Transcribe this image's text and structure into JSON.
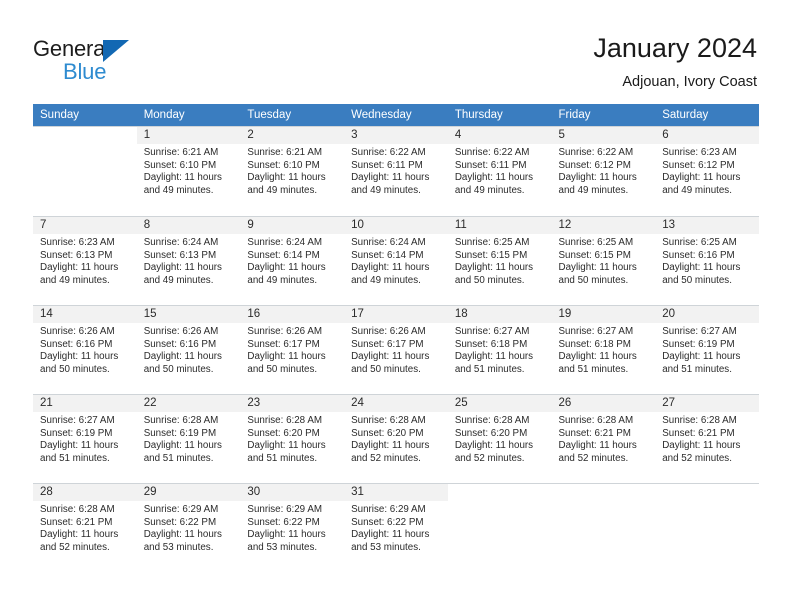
{
  "brand": {
    "name_part1": "General",
    "name_part2": "Blue",
    "accent_color": "#2e8bd0",
    "triangle_color": "#1268b3"
  },
  "header": {
    "title": "January 2024",
    "subtitle": "Adjouan, Ivory Coast"
  },
  "calendar": {
    "header_color": "#3a7dc0",
    "weekdays": [
      "Sunday",
      "Monday",
      "Tuesday",
      "Wednesday",
      "Thursday",
      "Friday",
      "Saturday"
    ],
    "weeks": [
      [
        {
          "day": "",
          "sunrise": "",
          "sunset": "",
          "daylight1": "",
          "daylight2": ""
        },
        {
          "day": "1",
          "sunrise": "Sunrise: 6:21 AM",
          "sunset": "Sunset: 6:10 PM",
          "daylight1": "Daylight: 11 hours",
          "daylight2": "and 49 minutes."
        },
        {
          "day": "2",
          "sunrise": "Sunrise: 6:21 AM",
          "sunset": "Sunset: 6:10 PM",
          "daylight1": "Daylight: 11 hours",
          "daylight2": "and 49 minutes."
        },
        {
          "day": "3",
          "sunrise": "Sunrise: 6:22 AM",
          "sunset": "Sunset: 6:11 PM",
          "daylight1": "Daylight: 11 hours",
          "daylight2": "and 49 minutes."
        },
        {
          "day": "4",
          "sunrise": "Sunrise: 6:22 AM",
          "sunset": "Sunset: 6:11 PM",
          "daylight1": "Daylight: 11 hours",
          "daylight2": "and 49 minutes."
        },
        {
          "day": "5",
          "sunrise": "Sunrise: 6:22 AM",
          "sunset": "Sunset: 6:12 PM",
          "daylight1": "Daylight: 11 hours",
          "daylight2": "and 49 minutes."
        },
        {
          "day": "6",
          "sunrise": "Sunrise: 6:23 AM",
          "sunset": "Sunset: 6:12 PM",
          "daylight1": "Daylight: 11 hours",
          "daylight2": "and 49 minutes."
        }
      ],
      [
        {
          "day": "7",
          "sunrise": "Sunrise: 6:23 AM",
          "sunset": "Sunset: 6:13 PM",
          "daylight1": "Daylight: 11 hours",
          "daylight2": "and 49 minutes."
        },
        {
          "day": "8",
          "sunrise": "Sunrise: 6:24 AM",
          "sunset": "Sunset: 6:13 PM",
          "daylight1": "Daylight: 11 hours",
          "daylight2": "and 49 minutes."
        },
        {
          "day": "9",
          "sunrise": "Sunrise: 6:24 AM",
          "sunset": "Sunset: 6:14 PM",
          "daylight1": "Daylight: 11 hours",
          "daylight2": "and 49 minutes."
        },
        {
          "day": "10",
          "sunrise": "Sunrise: 6:24 AM",
          "sunset": "Sunset: 6:14 PM",
          "daylight1": "Daylight: 11 hours",
          "daylight2": "and 49 minutes."
        },
        {
          "day": "11",
          "sunrise": "Sunrise: 6:25 AM",
          "sunset": "Sunset: 6:15 PM",
          "daylight1": "Daylight: 11 hours",
          "daylight2": "and 50 minutes."
        },
        {
          "day": "12",
          "sunrise": "Sunrise: 6:25 AM",
          "sunset": "Sunset: 6:15 PM",
          "daylight1": "Daylight: 11 hours",
          "daylight2": "and 50 minutes."
        },
        {
          "day": "13",
          "sunrise": "Sunrise: 6:25 AM",
          "sunset": "Sunset: 6:16 PM",
          "daylight1": "Daylight: 11 hours",
          "daylight2": "and 50 minutes."
        }
      ],
      [
        {
          "day": "14",
          "sunrise": "Sunrise: 6:26 AM",
          "sunset": "Sunset: 6:16 PM",
          "daylight1": "Daylight: 11 hours",
          "daylight2": "and 50 minutes."
        },
        {
          "day": "15",
          "sunrise": "Sunrise: 6:26 AM",
          "sunset": "Sunset: 6:16 PM",
          "daylight1": "Daylight: 11 hours",
          "daylight2": "and 50 minutes."
        },
        {
          "day": "16",
          "sunrise": "Sunrise: 6:26 AM",
          "sunset": "Sunset: 6:17 PM",
          "daylight1": "Daylight: 11 hours",
          "daylight2": "and 50 minutes."
        },
        {
          "day": "17",
          "sunrise": "Sunrise: 6:26 AM",
          "sunset": "Sunset: 6:17 PM",
          "daylight1": "Daylight: 11 hours",
          "daylight2": "and 50 minutes."
        },
        {
          "day": "18",
          "sunrise": "Sunrise: 6:27 AM",
          "sunset": "Sunset: 6:18 PM",
          "daylight1": "Daylight: 11 hours",
          "daylight2": "and 51 minutes."
        },
        {
          "day": "19",
          "sunrise": "Sunrise: 6:27 AM",
          "sunset": "Sunset: 6:18 PM",
          "daylight1": "Daylight: 11 hours",
          "daylight2": "and 51 minutes."
        },
        {
          "day": "20",
          "sunrise": "Sunrise: 6:27 AM",
          "sunset": "Sunset: 6:19 PM",
          "daylight1": "Daylight: 11 hours",
          "daylight2": "and 51 minutes."
        }
      ],
      [
        {
          "day": "21",
          "sunrise": "Sunrise: 6:27 AM",
          "sunset": "Sunset: 6:19 PM",
          "daylight1": "Daylight: 11 hours",
          "daylight2": "and 51 minutes."
        },
        {
          "day": "22",
          "sunrise": "Sunrise: 6:28 AM",
          "sunset": "Sunset: 6:19 PM",
          "daylight1": "Daylight: 11 hours",
          "daylight2": "and 51 minutes."
        },
        {
          "day": "23",
          "sunrise": "Sunrise: 6:28 AM",
          "sunset": "Sunset: 6:20 PM",
          "daylight1": "Daylight: 11 hours",
          "daylight2": "and 51 minutes."
        },
        {
          "day": "24",
          "sunrise": "Sunrise: 6:28 AM",
          "sunset": "Sunset: 6:20 PM",
          "daylight1": "Daylight: 11 hours",
          "daylight2": "and 52 minutes."
        },
        {
          "day": "25",
          "sunrise": "Sunrise: 6:28 AM",
          "sunset": "Sunset: 6:20 PM",
          "daylight1": "Daylight: 11 hours",
          "daylight2": "and 52 minutes."
        },
        {
          "day": "26",
          "sunrise": "Sunrise: 6:28 AM",
          "sunset": "Sunset: 6:21 PM",
          "daylight1": "Daylight: 11 hours",
          "daylight2": "and 52 minutes."
        },
        {
          "day": "27",
          "sunrise": "Sunrise: 6:28 AM",
          "sunset": "Sunset: 6:21 PM",
          "daylight1": "Daylight: 11 hours",
          "daylight2": "and 52 minutes."
        }
      ],
      [
        {
          "day": "28",
          "sunrise": "Sunrise: 6:28 AM",
          "sunset": "Sunset: 6:21 PM",
          "daylight1": "Daylight: 11 hours",
          "daylight2": "and 52 minutes."
        },
        {
          "day": "29",
          "sunrise": "Sunrise: 6:29 AM",
          "sunset": "Sunset: 6:22 PM",
          "daylight1": "Daylight: 11 hours",
          "daylight2": "and 53 minutes."
        },
        {
          "day": "30",
          "sunrise": "Sunrise: 6:29 AM",
          "sunset": "Sunset: 6:22 PM",
          "daylight1": "Daylight: 11 hours",
          "daylight2": "and 53 minutes."
        },
        {
          "day": "31",
          "sunrise": "Sunrise: 6:29 AM",
          "sunset": "Sunset: 6:22 PM",
          "daylight1": "Daylight: 11 hours",
          "daylight2": "and 53 minutes."
        },
        {
          "day": "",
          "sunrise": "",
          "sunset": "",
          "daylight1": "",
          "daylight2": ""
        },
        {
          "day": "",
          "sunrise": "",
          "sunset": "",
          "daylight1": "",
          "daylight2": ""
        },
        {
          "day": "",
          "sunrise": "",
          "sunset": "",
          "daylight1": "",
          "daylight2": ""
        }
      ]
    ]
  }
}
